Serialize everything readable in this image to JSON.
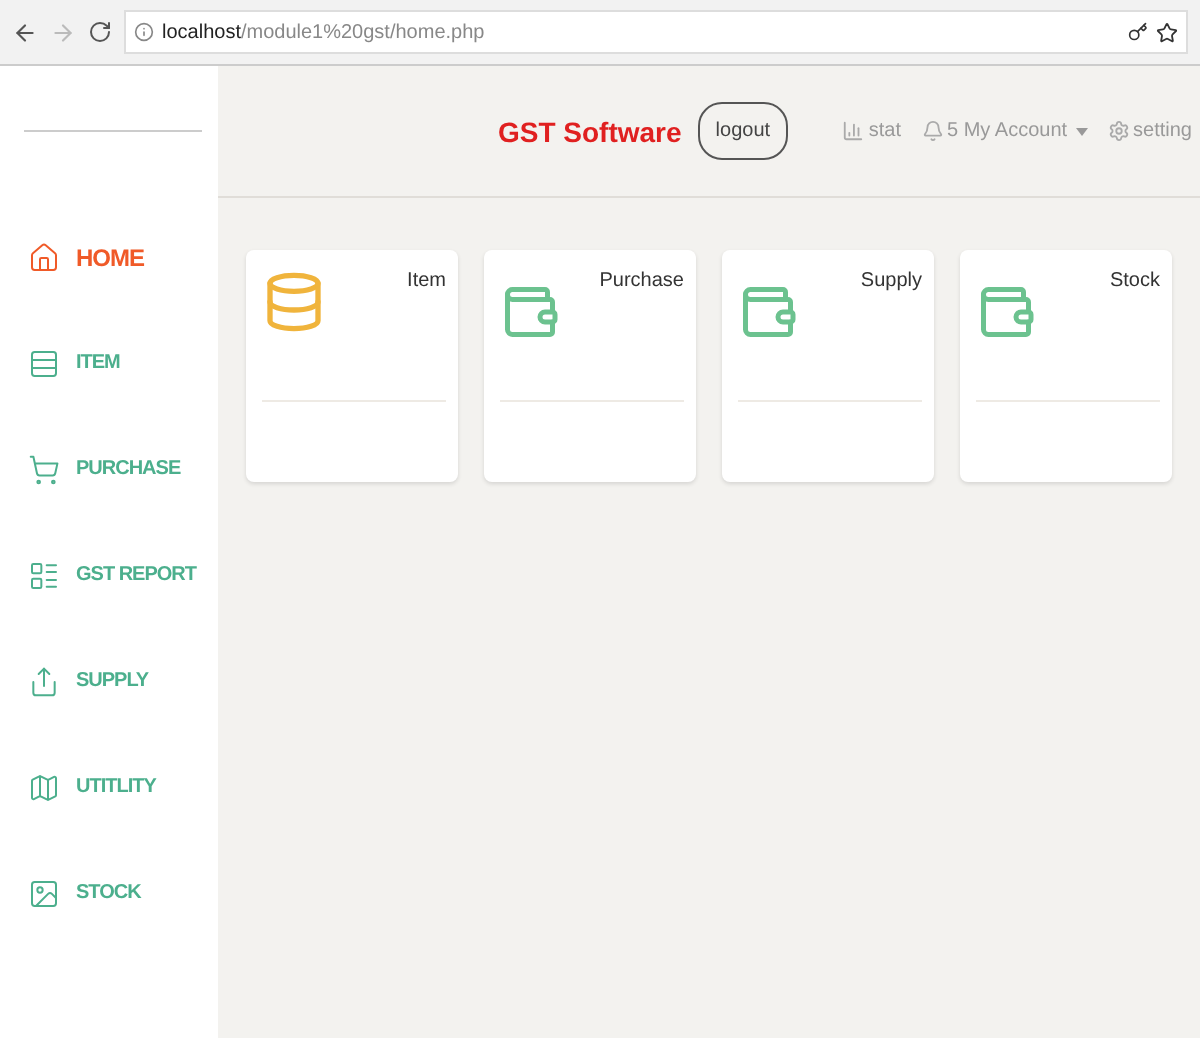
{
  "browser": {
    "host": "localhost",
    "path": "/module1%20gst/home.php"
  },
  "header": {
    "title": "GST Software",
    "logout": "logout",
    "links": [
      {
        "kind": "stat",
        "label": "stat"
      },
      {
        "kind": "account",
        "label": "5 My Account"
      },
      {
        "kind": "setting",
        "label": "setting"
      }
    ]
  },
  "sidebar": {
    "items": [
      {
        "kind": "home",
        "label": "HOME",
        "selected": true
      },
      {
        "kind": "list",
        "label": "ITEM",
        "selected": false
      },
      {
        "kind": "cart",
        "label": "PURCHASE",
        "selected": false
      },
      {
        "kind": "report",
        "label": "GST REPORT",
        "selected": false
      },
      {
        "kind": "upload",
        "label": "SUPPLY",
        "selected": false
      },
      {
        "kind": "map",
        "label": "UTITLITY",
        "selected": false
      },
      {
        "kind": "image",
        "label": "STOCK",
        "selected": false
      }
    ]
  },
  "cards": [
    {
      "kind": "coins",
      "title": "Item"
    },
    {
      "kind": "wallet",
      "title": "Purchase"
    },
    {
      "kind": "wallet",
      "title": "Supply"
    },
    {
      "kind": "wallet",
      "title": "Stock"
    }
  ]
}
